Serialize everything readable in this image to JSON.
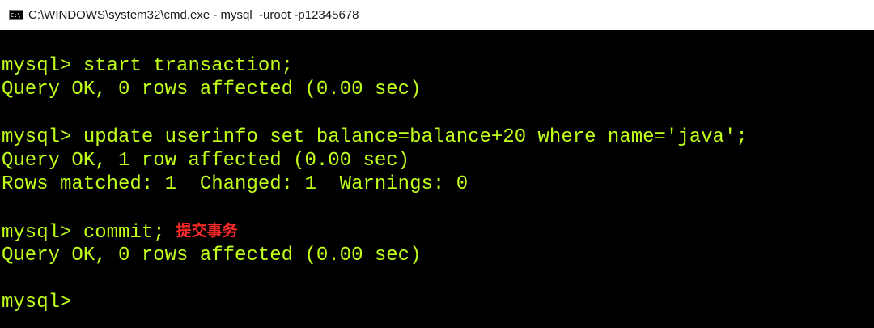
{
  "window": {
    "title": "C:\\WINDOWS\\system32\\cmd.exe - mysql  -uroot -p12345678",
    "icon": "cmd-icon"
  },
  "console": {
    "lines": [
      "mysql> start transaction;",
      "Query OK, 0 rows affected (0.00 sec)",
      "",
      "mysql> update userinfo set balance=balance+20 where name='java';",
      "Query OK, 1 row affected (0.00 sec)",
      "Rows matched: 1  Changed: 1  Warnings: 0",
      "",
      "mysql> commit;",
      "Query OK, 0 rows affected (0.00 sec)",
      "",
      "mysql>"
    ],
    "annotation": "提交事务",
    "text_color": "#c0ff1a",
    "annotation_color": "#ff2a2a",
    "background": "#000000"
  }
}
